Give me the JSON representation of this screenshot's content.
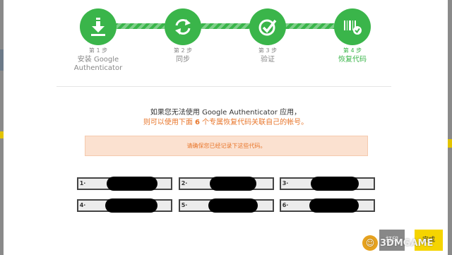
{
  "steps": [
    {
      "num": "第 1 步",
      "title": "安装 Google Authenticator",
      "icon": "download-icon"
    },
    {
      "num": "第 2 步",
      "title": "同步",
      "icon": "sync-icon"
    },
    {
      "num": "第 3 步",
      "title": "验证",
      "icon": "check-icon"
    },
    {
      "num": "第 4 步",
      "title": "恢复代码",
      "icon": "barcode-check-icon"
    }
  ],
  "message": {
    "line1": "如果您无法使用 Google Authenticator 应用，",
    "line2_pre": "则可以使用下面 ",
    "line2_count": "6",
    "line2_post": " 个专属恢复代码关联自己的帐号。"
  },
  "notice": "请确保您已经记录下这些代码。",
  "codes": [
    {
      "index": "1·"
    },
    {
      "index": "2·"
    },
    {
      "index": "3·"
    },
    {
      "index": "4·"
    },
    {
      "index": "5·"
    },
    {
      "index": "6·"
    }
  ],
  "buttons": {
    "print": "打印",
    "done": "完成"
  },
  "watermark": "3DMGAME",
  "colors": {
    "accent": "#3ab54a",
    "warning": "#e8762b",
    "done": "#f5d400"
  }
}
